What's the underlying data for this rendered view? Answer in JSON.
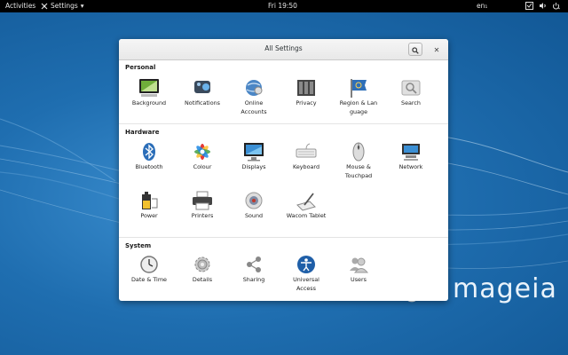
{
  "topbar": {
    "activities": "Activities",
    "app_menu": "Settings",
    "clock": "Fri 19:50",
    "lang": "en₁",
    "icons": [
      "network-icon",
      "volume-icon",
      "power-icon"
    ]
  },
  "window": {
    "title": "All Settings",
    "search_icon": "search-icon",
    "close_icon": "close-icon"
  },
  "sections": {
    "personal": {
      "title": "Personal",
      "items": [
        {
          "label": "Background",
          "icon": "background-icon"
        },
        {
          "label": "Notifications",
          "icon": "notifications-icon"
        },
        {
          "label": "Online\nAccounts",
          "icon": "online-accounts-icon"
        },
        {
          "label": "Privacy",
          "icon": "privacy-icon"
        },
        {
          "label": "Region & Lan\nguage",
          "icon": "region-language-icon"
        },
        {
          "label": "Search",
          "icon": "search-settings-icon"
        }
      ]
    },
    "hardware": {
      "title": "Hardware",
      "items": [
        {
          "label": "Bluetooth",
          "icon": "bluetooth-icon"
        },
        {
          "label": "Colour",
          "icon": "colour-icon"
        },
        {
          "label": "Displays",
          "icon": "displays-icon"
        },
        {
          "label": "Keyboard",
          "icon": "keyboard-icon"
        },
        {
          "label": "Mouse &\nTouchpad",
          "icon": "mouse-icon"
        },
        {
          "label": "Network",
          "icon": "network-settings-icon"
        },
        {
          "label": "Power",
          "icon": "power-settings-icon"
        },
        {
          "label": "Printers",
          "icon": "printer-icon"
        },
        {
          "label": "Sound",
          "icon": "sound-icon"
        },
        {
          "label": "Wacom Tablet",
          "icon": "wacom-tablet-icon"
        }
      ]
    },
    "system": {
      "title": "System",
      "items": [
        {
          "label": "Date & Time",
          "icon": "clock-icon"
        },
        {
          "label": "Details",
          "icon": "details-gear-icon"
        },
        {
          "label": "Sharing",
          "icon": "sharing-icon"
        },
        {
          "label": "Universal\nAccess",
          "icon": "universal-access-icon"
        },
        {
          "label": "Users",
          "icon": "users-icon"
        }
      ]
    }
  },
  "desktop": {
    "logo_text": "mageia"
  }
}
